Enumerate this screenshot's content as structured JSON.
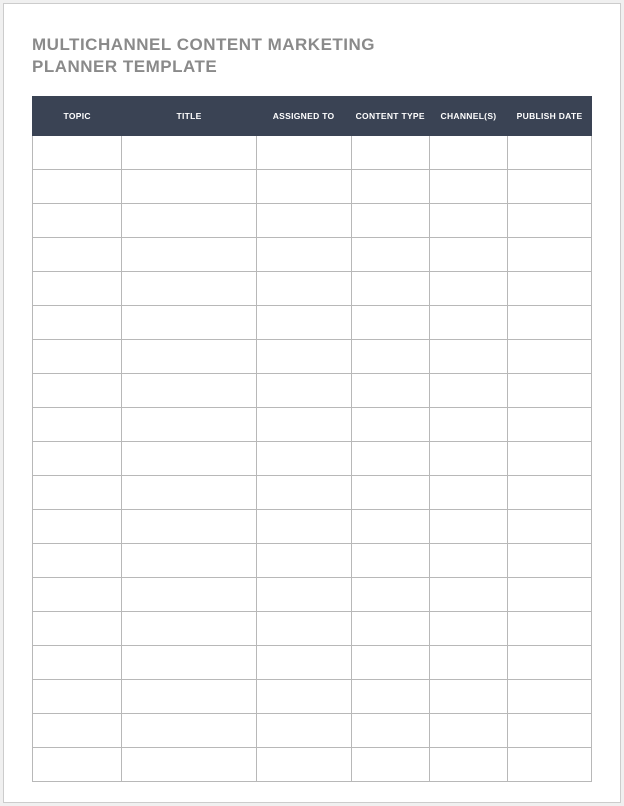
{
  "title_line1": "MULTICHANNEL CONTENT MARKETING",
  "title_line2": "PLANNER TEMPLATE",
  "table": {
    "headers": [
      "TOPIC",
      "TITLE",
      "ASSIGNED TO",
      "CONTENT TYPE",
      "CHANNEL(S)",
      "PUBLISH DATE"
    ],
    "row_count": 19,
    "rows": [
      [
        "",
        "",
        "",
        "",
        "",
        ""
      ],
      [
        "",
        "",
        "",
        "",
        "",
        ""
      ],
      [
        "",
        "",
        "",
        "",
        "",
        ""
      ],
      [
        "",
        "",
        "",
        "",
        "",
        ""
      ],
      [
        "",
        "",
        "",
        "",
        "",
        ""
      ],
      [
        "",
        "",
        "",
        "",
        "",
        ""
      ],
      [
        "",
        "",
        "",
        "",
        "",
        ""
      ],
      [
        "",
        "",
        "",
        "",
        "",
        ""
      ],
      [
        "",
        "",
        "",
        "",
        "",
        ""
      ],
      [
        "",
        "",
        "",
        "",
        "",
        ""
      ],
      [
        "",
        "",
        "",
        "",
        "",
        ""
      ],
      [
        "",
        "",
        "",
        "",
        "",
        ""
      ],
      [
        "",
        "",
        "",
        "",
        "",
        ""
      ],
      [
        "",
        "",
        "",
        "",
        "",
        ""
      ],
      [
        "",
        "",
        "",
        "",
        "",
        ""
      ],
      [
        "",
        "",
        "",
        "",
        "",
        ""
      ],
      [
        "",
        "",
        "",
        "",
        "",
        ""
      ],
      [
        "",
        "",
        "",
        "",
        "",
        ""
      ],
      [
        "",
        "",
        "",
        "",
        "",
        ""
      ]
    ]
  }
}
